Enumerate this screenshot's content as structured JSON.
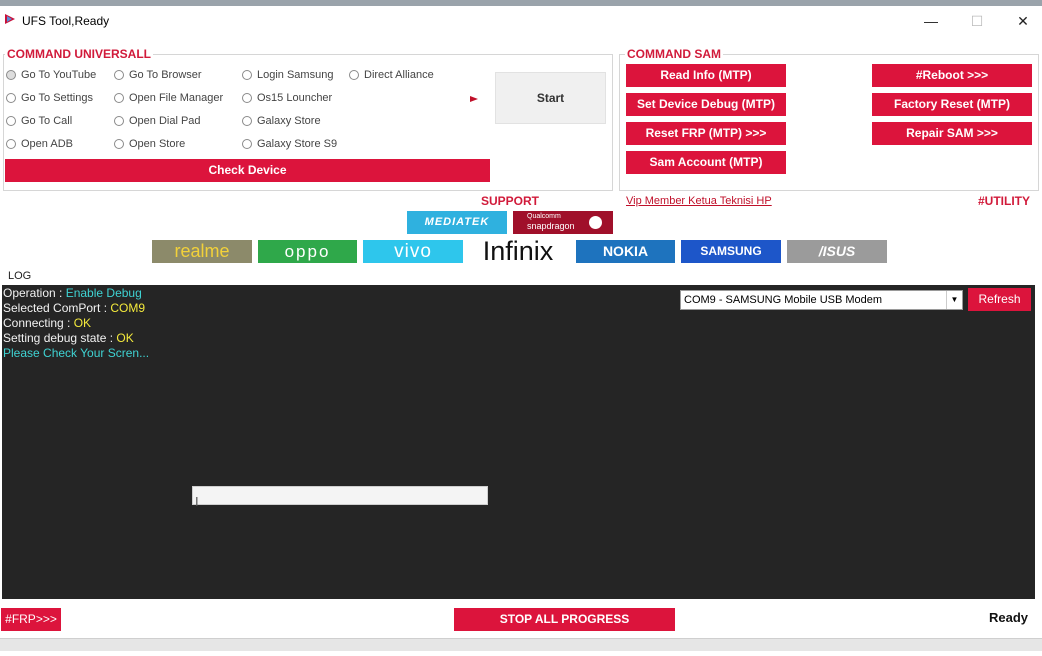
{
  "window": {
    "title": "UFS Tool,Ready",
    "minimize_glyph": "—",
    "maximize_glyph": "☐",
    "close_glyph": "✕"
  },
  "universal": {
    "title": "COMMAND UNIVERSALL",
    "options": [
      {
        "label": "Go To YouTube",
        "selected": true
      },
      {
        "label": "Go To  Settings",
        "selected": false
      },
      {
        "label": "Go To  Call",
        "selected": false
      },
      {
        "label": "Open ADB",
        "selected": false
      },
      {
        "label": "Go To Browser",
        "selected": false
      },
      {
        "label": "Open File Manager",
        "selected": false
      },
      {
        "label": "Open Dial Pad",
        "selected": false
      },
      {
        "label": "Open Store",
        "selected": false
      },
      {
        "label": "Login Samsung",
        "selected": false
      },
      {
        "label": "Os15 Louncher",
        "selected": false
      },
      {
        "label": "Galaxy Store",
        "selected": false
      },
      {
        "label": "Galaxy Store S9",
        "selected": false
      },
      {
        "label": "Direct Alliance",
        "selected": false
      }
    ],
    "start_label": "Start",
    "check_device_label": "Check Device"
  },
  "sam": {
    "title": "COMMAND SAM",
    "buttons": [
      "Read Info (MTP)",
      "Set Device Debug (MTP)",
      "Reset FRP (MTP) >>>",
      "Sam Account (MTP)",
      "#Reboot >>>",
      "Factory Reset (MTP)",
      "Repair SAM >>>"
    ]
  },
  "support": {
    "label": "SUPPORT",
    "vip_link": "Vip Member  Ketua Teknisi HP",
    "utility_label": "#UTILITY",
    "brands": [
      "MEDIATEK",
      "Qualcomm",
      "snapdragon",
      "realme",
      "oppo",
      "vivo",
      "Infinix",
      "NOKIA",
      "SAMSUNG",
      "/ISUS"
    ]
  },
  "log": {
    "title": "LOG",
    "lines": [
      {
        "key": "Operation : ",
        "value": "Enable Debug"
      },
      {
        "key": "Selected ComPort : ",
        "value": "COM9"
      },
      {
        "key": "Connecting : ",
        "value": "OK"
      },
      {
        "key": "Setting debug state : ",
        "value": "OK"
      },
      {
        "key": "",
        "value": "Please Check Your Scren..."
      }
    ],
    "port_selected": "COM9 - SAMSUNG Mobile USB Modem",
    "refresh_label": "Refresh"
  },
  "footer": {
    "frp_label": "#FRP>>>",
    "stop_label": "STOP ALL PROGRESS",
    "status": "Ready"
  },
  "colors": {
    "accent": "#dc143c",
    "log_bg": "#252525",
    "cyan": "#3fd3d3",
    "yellow": "#f4ea3c"
  }
}
